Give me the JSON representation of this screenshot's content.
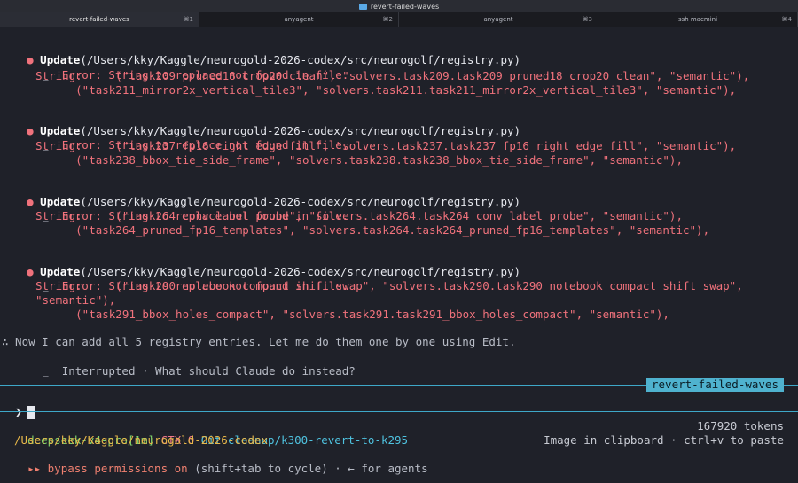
{
  "window": {
    "title": "revert-failed-waves"
  },
  "tabs": [
    {
      "label": "revert-failed-waves",
      "key": "⌘1",
      "active": true
    },
    {
      "label": "anyagent",
      "key": "⌘2",
      "active": false
    },
    {
      "label": "anyagent",
      "key": "⌘3",
      "active": false
    },
    {
      "label": "ssh macmini",
      "key": "⌘4",
      "active": false
    }
  ],
  "blocks": [
    {
      "action": "Update",
      "path": "(/Users/kky/Kaggle/neurogold-2026-codex/src/neurogolf/registry.py)",
      "error": "Error: String to replace not found in file.",
      "string_lines": [
        "String:     (\"task209_pruned18_crop20_clean\", \"solvers.task209.task209_pruned18_crop20_clean\", \"semantic\"),",
        "      (\"task211_mirror2x_vertical_tile3\", \"solvers.task211.task211_mirror2x_vertical_tile3\", \"semantic\"),"
      ]
    },
    {
      "action": "Update",
      "path": "(/Users/kky/Kaggle/neurogold-2026-codex/src/neurogolf/registry.py)",
      "error": "Error: String to replace not found in file.",
      "string_lines": [
        "String:     (\"task237_fp16_right_edge_fill\", \"solvers.task237.task237_fp16_right_edge_fill\", \"semantic\"),",
        "      (\"task238_bbox_tie_side_frame\", \"solvers.task238.task238_bbox_tie_side_frame\", \"semantic\"),"
      ]
    },
    {
      "action": "Update",
      "path": "(/Users/kky/Kaggle/neurogold-2026-codex/src/neurogolf/registry.py)",
      "error": "Error: String to replace not found in file.",
      "string_lines": [
        "String:     (\"task264_conv_label_probe\", \"solvers.task264.task264_conv_label_probe\", \"semantic\"),",
        "      (\"task264_pruned_fp16_templates\", \"solvers.task264.task264_pruned_fp16_templates\", \"semantic\"),"
      ]
    },
    {
      "action": "Update",
      "path": "(/Users/kky/Kaggle/neurogold-2026-codex/src/neurogolf/registry.py)",
      "error": "Error: String to replace not found in file.",
      "string_lines": [
        "String:     (\"task290_notebook_compact_shift_swap\", \"solvers.task290.task290_notebook_compact_shift_swap\",",
        "\"semantic\"),",
        "      (\"task291_bbox_holes_compact\", \"solvers.task291.task291_bbox_holes_compact\", \"semantic\"),"
      ]
    }
  ],
  "tree_branch": "⎿",
  "assistant_msg": "∴ Now I can add all 5 registry entries. Let me do them one by one using Edit.",
  "interrupted_msg": "Interrupted · What should Claude do instead?",
  "session_badge": "revert-failed-waves",
  "prompt_symbol": "❯",
  "status": {
    "model": "deepseek-v4-pro[1m]",
    "ctx": "CTX 0",
    "git": "Git cleanup/k300-revert-to-k295",
    "cwd": "/Users/kky/Kaggle/neurogold-2026-codex",
    "bypass_prefix": "▸▸ bypass permissions on",
    "bypass_suffix": " (shift+tab to cycle) · ← for agents",
    "tokens": "167920 tokens",
    "clipboard": "Image in clipboard · ctrl+v to paste"
  },
  "colors": {
    "background": "#1f2129",
    "error": "#f0727c",
    "accent": "#4fb2cf",
    "model": "#7fd46c",
    "git": "#4fc3e0",
    "cwd": "#e8b84a"
  }
}
